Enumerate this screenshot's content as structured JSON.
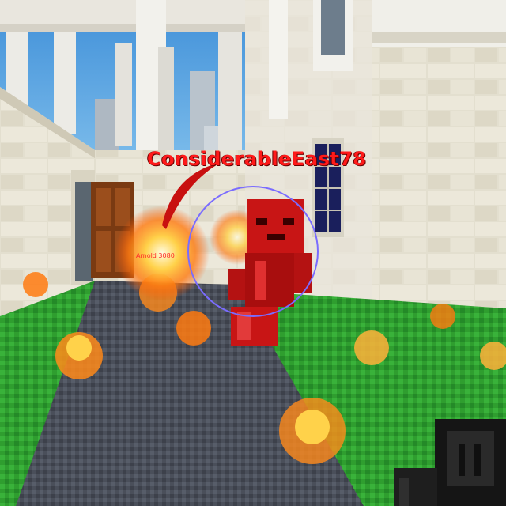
{
  "hud": {
    "target_player_name": "ConsiderableEast78",
    "secondary_player_label": "Arnold 3080"
  },
  "colors": {
    "nametag": "#ff1a1a",
    "sky": "#5aa8e0",
    "grass": "#2f9e2f",
    "path": "#4a4f5a",
    "fire": "#ff8a1a",
    "aim_reticle": "#7a6cff"
  },
  "icons": {
    "crosshair": "aim-reticle-circle",
    "weapon": "first-person-weapon"
  }
}
